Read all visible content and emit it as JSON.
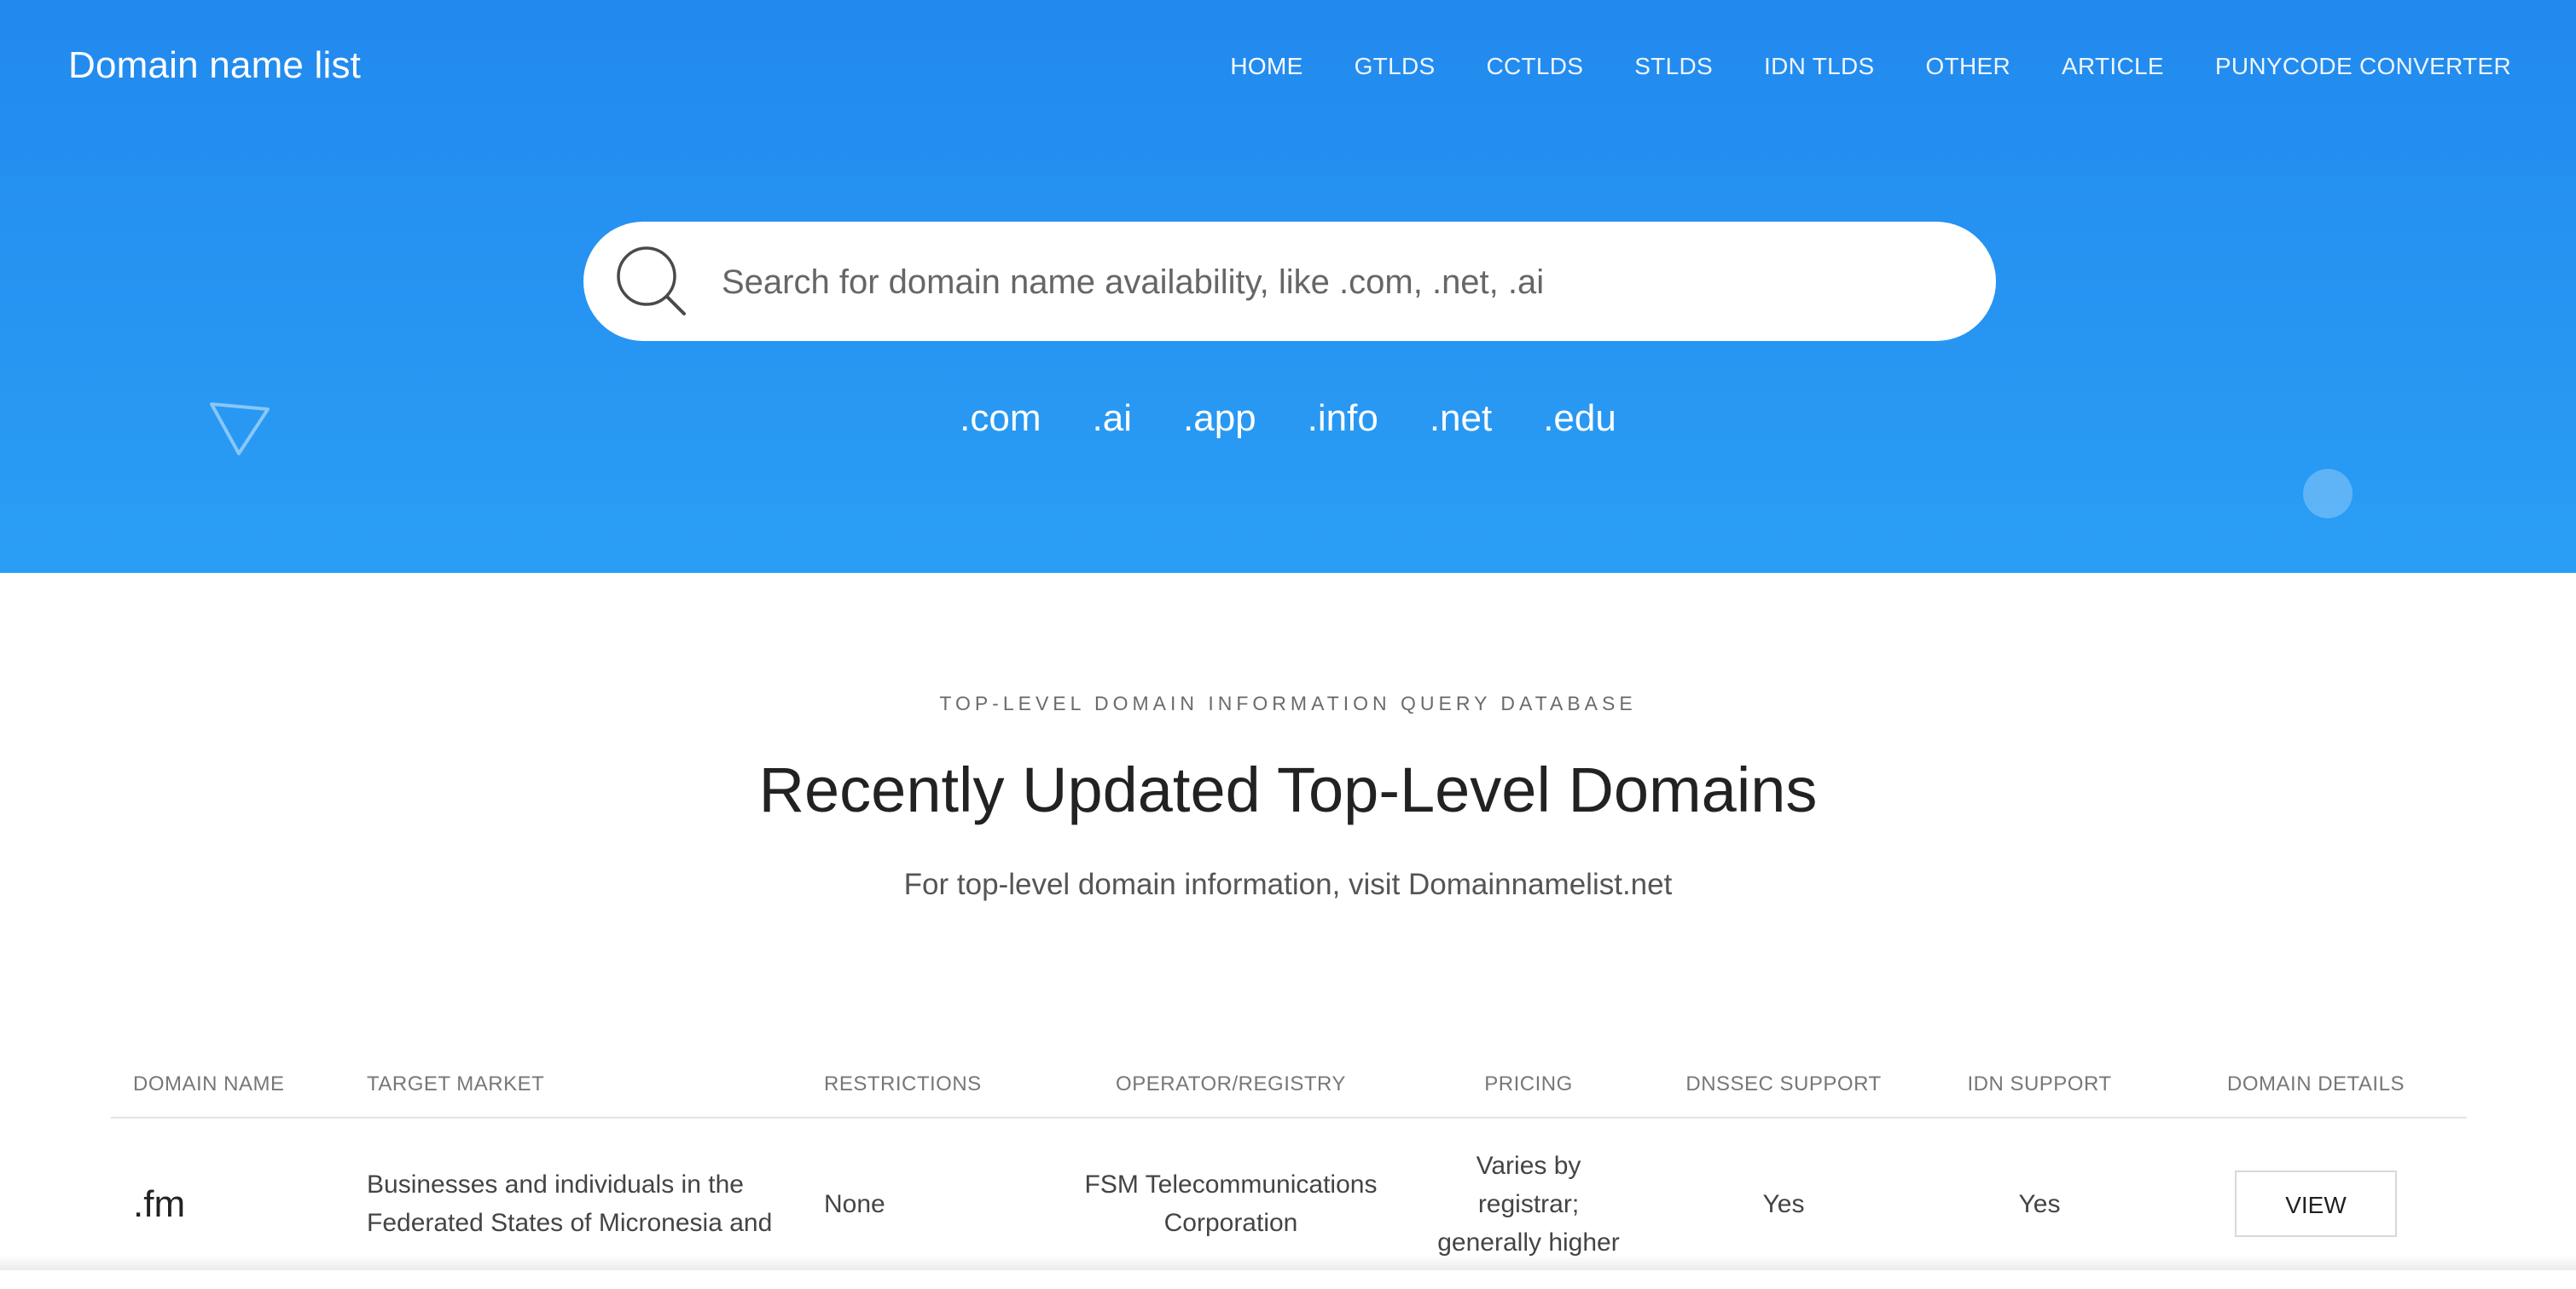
{
  "header": {
    "brand": "Domain name list",
    "nav": [
      {
        "label": "HOME"
      },
      {
        "label": "GTLDS"
      },
      {
        "label": "CCTLDS"
      },
      {
        "label": "STLDS"
      },
      {
        "label": "IDN TLDS"
      },
      {
        "label": "OTHER"
      },
      {
        "label": "ARTICLE"
      },
      {
        "label": "PUNYCODE CONVERTER"
      }
    ]
  },
  "search": {
    "placeholder": "Search for domain name availability, like .com, .net, .ai",
    "value": "",
    "quick_tlds": [
      ".com",
      ".ai",
      ".app",
      ".info",
      ".net",
      ".edu"
    ]
  },
  "section": {
    "eyebrow": "TOP-LEVEL DOMAIN INFORMATION QUERY DATABASE",
    "title": "Recently Updated Top-Level Domains",
    "subtitle": "For top-level domain information, visit Domainnamelist.net"
  },
  "table": {
    "headers": [
      "DOMAIN NAME",
      "TARGET MARKET",
      "RESTRICTIONS",
      "OPERATOR/REGISTRY",
      "PRICING",
      "DNSSEC SUPPORT",
      "IDN SUPPORT",
      "DOMAIN DETAILS"
    ],
    "rows": [
      {
        "domain": ".fm",
        "target_market": "Businesses and individuals in the Federated States of Micronesia and",
        "restrictions": "None",
        "operator": "FSM Telecommunications Corporation",
        "pricing": "Varies by registrar; generally higher",
        "dnssec": "Yes",
        "idn": "Yes",
        "details_label": "VIEW"
      }
    ]
  },
  "colors": {
    "hero_top": "#2289ee",
    "hero_bottom": "#2a9ef5",
    "text_dark": "#222222"
  }
}
